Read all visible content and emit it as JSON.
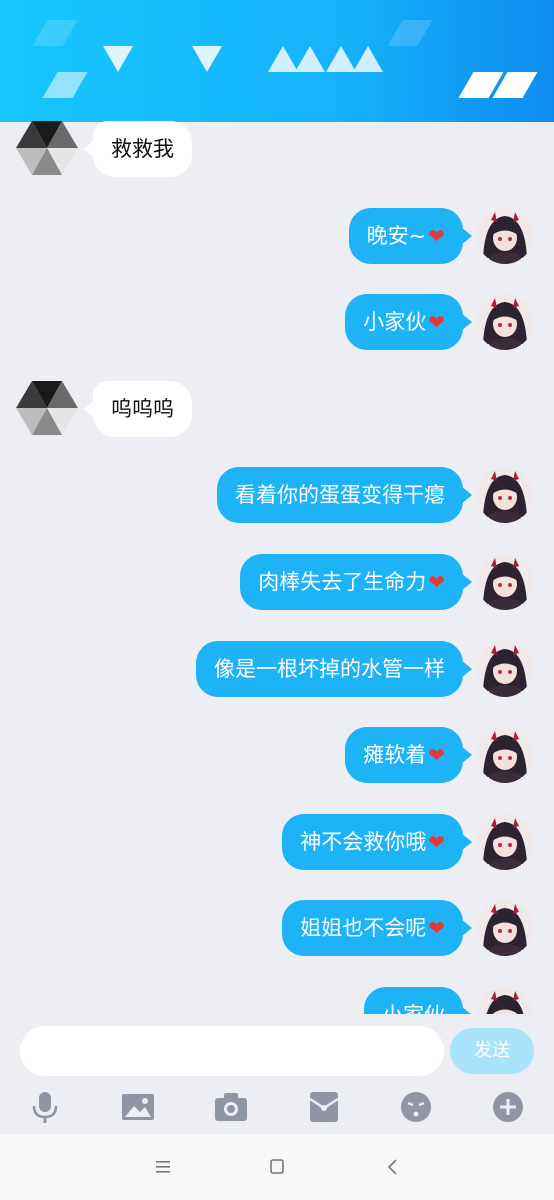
{
  "messages": [
    {
      "side": "in",
      "text": "救救我",
      "heart": false
    },
    {
      "side": "out",
      "text": "晚安~",
      "heart": true
    },
    {
      "side": "out",
      "text": "小家伙",
      "heart": true
    },
    {
      "side": "in",
      "text": "呜呜呜",
      "heart": false
    },
    {
      "side": "out",
      "text": "看着你的蛋蛋变得干瘪",
      "heart": false
    },
    {
      "side": "out",
      "text": "肉棒失去了生命力",
      "heart": true
    },
    {
      "side": "out",
      "text": "像是一根坏掉的水管一样",
      "heart": false
    },
    {
      "side": "out",
      "text": "瘫软着",
      "heart": true
    },
    {
      "side": "out",
      "text": "神不会救你哦",
      "heart": true
    },
    {
      "side": "out",
      "text": "姐姐也不会呢",
      "heart": true
    },
    {
      "side": "out",
      "text": "小家伙",
      "heart": false
    }
  ],
  "input": {
    "value": "",
    "placeholder": ""
  },
  "send_label": "发送",
  "toolbar_icons": [
    "mic-icon",
    "image-icon",
    "camera-icon",
    "red-packet-icon",
    "emoji-icon",
    "plus-icon"
  ],
  "nav_icons": [
    "menu-icon",
    "home-icon",
    "back-icon"
  ],
  "colors": {
    "accent": "#1eb2f6",
    "header": "#17b3fb",
    "heart": "#e53935",
    "send_disabled": "#a9e3fb"
  }
}
